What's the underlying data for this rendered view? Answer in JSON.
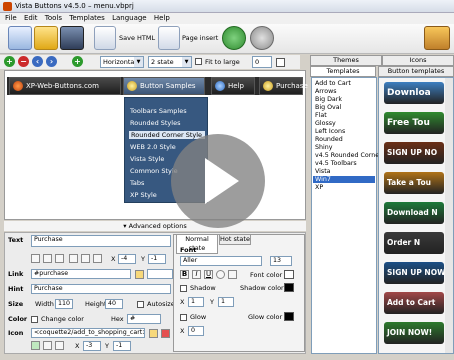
{
  "window": {
    "title": "Vista Buttons v4.5.0 – menu.vbprj"
  },
  "menu": [
    "File",
    "Edit",
    "Tools",
    "Templates",
    "Language",
    "Help"
  ],
  "toolbar": {
    "save_html": "Save HTML",
    "page_insert": "Page insert"
  },
  "toolbar2": {
    "orientation": "Horizontal",
    "state": "2 state",
    "fit_label": "Fit to large",
    "fit_value": "0"
  },
  "preview": {
    "menu_items": [
      "XP-Web-Buttons.com",
      "Button Samples",
      "Help",
      "Purchase"
    ],
    "submenu": [
      "Toolbars Samples",
      "Rounded Styles",
      "Rounded Corner Style",
      "WEB 2.0 Style",
      "Vista Style",
      "Common Style",
      "Tabs",
      "XP Style"
    ],
    "advanced": "Advanced options"
  },
  "tabs": {
    "themes": "Themes",
    "icons": "Icons",
    "templates": "Templates",
    "button_templates": "Button templates"
  },
  "themes": [
    "Add to Cart",
    "Arrows",
    "Big Dark",
    "Big Oval",
    "Flat",
    "Glossy",
    "Left Icons",
    "Rounded",
    "Shiny",
    "v4.5 Rounded Corner",
    "v4.5 Toolbars",
    "Vista",
    "Win7",
    "XP"
  ],
  "themes_selected": "Win7",
  "templates": [
    {
      "label": "Downloa",
      "color": "#3d7fc0"
    },
    {
      "label": "Free Tou",
      "color": "#2f8b2f"
    },
    {
      "label": "SIGN UP NO",
      "color": "#6b2f16"
    },
    {
      "label": "Take a Tou",
      "color": "#b07318"
    },
    {
      "label": "Download N",
      "color": "#1e7a3a"
    },
    {
      "label": "Order N",
      "color": "#3a3a3a"
    },
    {
      "label": "SIGN UP NOW",
      "color": "#1b4f86"
    },
    {
      "label": "Add to Cart",
      "color": "#a24848"
    },
    {
      "label": "JOIN NOW!",
      "color": "#2d7a2d"
    }
  ],
  "props": {
    "text_label": "Text",
    "text_value": "Purchase",
    "x_label": "X",
    "x_value": "-4",
    "y_label": "Y",
    "y_value": "-1",
    "link_label": "Link",
    "link_value": "#purchase",
    "hint_label": "Hint",
    "hint_value": "Purchase",
    "size_label": "Size",
    "width_label": "Width",
    "width_value": "110",
    "height_label": "Height",
    "height_value": "40",
    "autosize": "Autosize",
    "color_label": "Color",
    "change_color": "Change color",
    "hex_label": "Hex",
    "hex_value": "#",
    "icon_label": "Icon",
    "icon_value": "<coquette2/add_to_shopping_cart>",
    "icon_x_value": "-3",
    "icon_y_value": "-1"
  },
  "state": {
    "normal_tab": "Normal state",
    "hot_tab": "Hot state",
    "font_label": "Font",
    "font_value": "Aller",
    "font_size": "13",
    "font_color": "Font color",
    "shadow": "Shadow",
    "shadow_color": "Shadow color",
    "sx_value": "1",
    "sy_value": "1",
    "glow": "Glow",
    "glow_color": "Glow color",
    "glow_x": "0"
  }
}
